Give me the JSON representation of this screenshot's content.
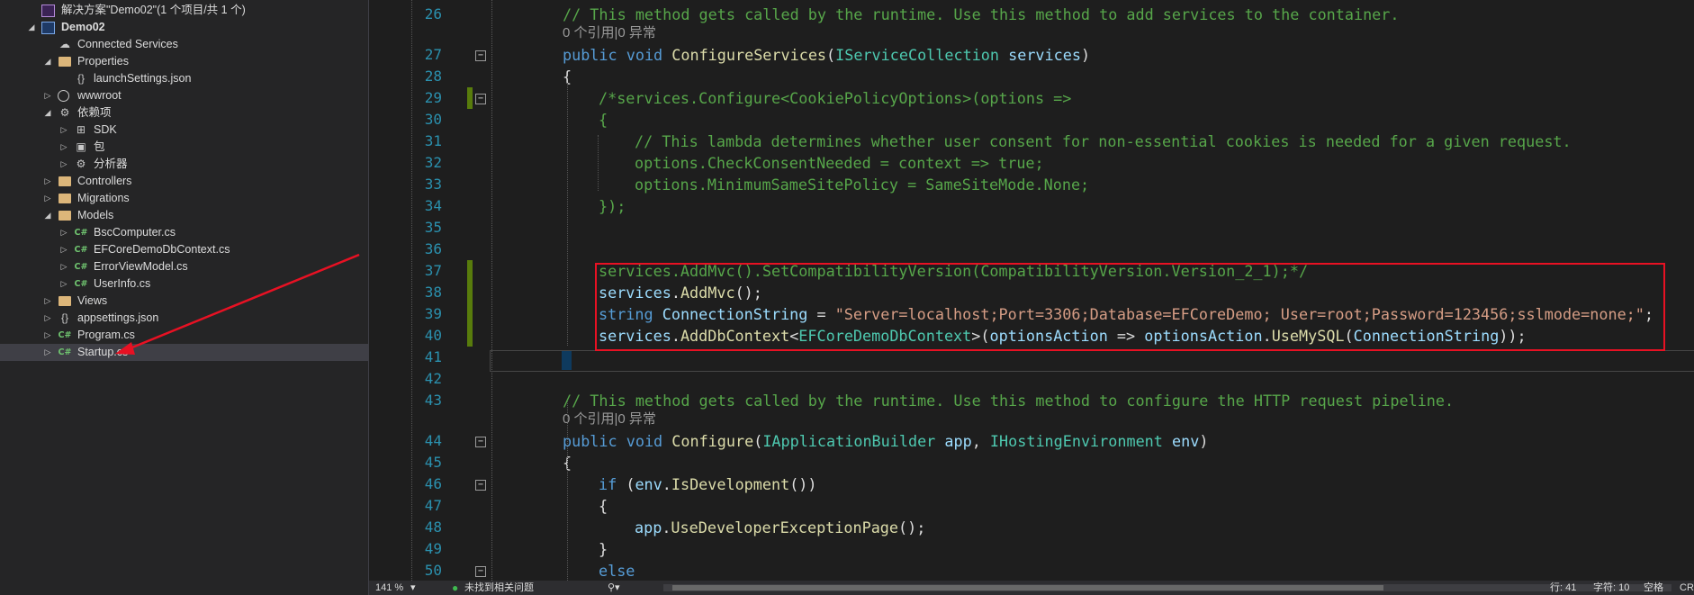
{
  "solution_explorer": {
    "items": [
      {
        "label": "解决方案\"Demo02\"(1 个项目/共 1 个)",
        "level": 0,
        "icon": "solution-icon",
        "expander": "",
        "bold": false
      },
      {
        "label": "Demo02",
        "level": 0,
        "icon": "project-icon",
        "expander": "◢",
        "bold": true
      },
      {
        "label": "Connected Services",
        "level": 1,
        "icon": "connected-services-icon",
        "expander": "",
        "bold": false
      },
      {
        "label": "Properties",
        "level": 1,
        "icon": "properties-folder-icon",
        "expander": "◢",
        "bold": false
      },
      {
        "label": "launchSettings.json",
        "level": 2,
        "icon": "json-file-icon",
        "expander": "",
        "bold": false
      },
      {
        "label": "wwwroot",
        "level": 1,
        "icon": "globe-icon",
        "expander": "▷",
        "bold": false
      },
      {
        "label": "依赖项",
        "level": 1,
        "icon": "dependencies-icon",
        "expander": "◢",
        "bold": false
      },
      {
        "label": "SDK",
        "level": 2,
        "icon": "sdk-icon",
        "expander": "▷",
        "bold": false
      },
      {
        "label": "包",
        "level": 2,
        "icon": "package-icon",
        "expander": "▷",
        "bold": false
      },
      {
        "label": "分析器",
        "level": 2,
        "icon": "analyzer-icon",
        "expander": "▷",
        "bold": false
      },
      {
        "label": "Controllers",
        "level": 1,
        "icon": "folder-icon",
        "expander": "▷",
        "bold": false
      },
      {
        "label": "Migrations",
        "level": 1,
        "icon": "folder-icon",
        "expander": "▷",
        "bold": false
      },
      {
        "label": "Models",
        "level": 1,
        "icon": "folder-icon",
        "expander": "◢",
        "bold": false
      },
      {
        "label": "BscComputer.cs",
        "level": 2,
        "icon": "csharp-file-icon",
        "expander": "▷",
        "bold": false
      },
      {
        "label": "EFCoreDemoDbContext.cs",
        "level": 2,
        "icon": "csharp-file-icon",
        "expander": "▷",
        "bold": false
      },
      {
        "label": "ErrorViewModel.cs",
        "level": 2,
        "icon": "csharp-file-icon",
        "expander": "▷",
        "bold": false
      },
      {
        "label": "UserInfo.cs",
        "level": 2,
        "icon": "csharp-file-icon",
        "expander": "▷",
        "bold": false
      },
      {
        "label": "Views",
        "level": 1,
        "icon": "folder-icon",
        "expander": "▷",
        "bold": false
      },
      {
        "label": "appsettings.json",
        "level": 1,
        "icon": "json-file-icon",
        "expander": "▷",
        "bold": false
      },
      {
        "label": "Program.cs",
        "level": 1,
        "icon": "csharp-file-icon",
        "expander": "▷",
        "bold": false
      },
      {
        "label": "Startup.cs",
        "level": 1,
        "icon": "csharp-file-icon",
        "expander": "▷",
        "bold": false,
        "selected": true
      }
    ]
  },
  "editor": {
    "lines": [
      {
        "kind": "code",
        "no": "26",
        "indent": 0,
        "tokens": [
          [
            "com",
            "// This method gets called by the runtime. Use this method to add services to the container."
          ]
        ]
      },
      {
        "kind": "lens",
        "text": "0 个引用|0 异常"
      },
      {
        "kind": "code",
        "no": "27",
        "indent": 0,
        "fold": "−",
        "tokens": [
          [
            "kw",
            "public"
          ],
          [
            "plain",
            " "
          ],
          [
            "kw",
            "void"
          ],
          [
            "plain",
            " "
          ],
          [
            "meth",
            "ConfigureServices"
          ],
          [
            "plain",
            "("
          ],
          [
            "type",
            "IServiceCollection"
          ],
          [
            "plain",
            " "
          ],
          [
            "id",
            "services"
          ],
          [
            "plain",
            ")"
          ]
        ]
      },
      {
        "kind": "code",
        "no": "28",
        "indent": 0,
        "tokens": [
          [
            "plain",
            "{"
          ]
        ]
      },
      {
        "kind": "code",
        "no": "29",
        "indent": 1,
        "change": true,
        "fold": "−",
        "tokens": [
          [
            "com",
            "/*services.Configure<CookiePolicyOptions>(options =>"
          ]
        ]
      },
      {
        "kind": "code",
        "no": "30",
        "indent": 1,
        "tokens": [
          [
            "com",
            "{"
          ]
        ]
      },
      {
        "kind": "code",
        "no": "31",
        "indent": 2,
        "tokens": [
          [
            "com",
            "// This lambda determines whether user consent for non-essential cookies is needed for a given request."
          ]
        ]
      },
      {
        "kind": "code",
        "no": "32",
        "indent": 2,
        "tokens": [
          [
            "com",
            "options.CheckConsentNeeded = context => true;"
          ]
        ]
      },
      {
        "kind": "code",
        "no": "33",
        "indent": 2,
        "tokens": [
          [
            "com",
            "options.MinimumSameSitePolicy = SameSiteMode.None;"
          ]
        ]
      },
      {
        "kind": "code",
        "no": "34",
        "indent": 1,
        "tokens": [
          [
            "com",
            "});"
          ]
        ]
      },
      {
        "kind": "code",
        "no": "35",
        "indent": 0,
        "tokens": []
      },
      {
        "kind": "code",
        "no": "36",
        "indent": 0,
        "tokens": []
      },
      {
        "kind": "code",
        "no": "37",
        "indent": 1,
        "change": true,
        "tokens": [
          [
            "com",
            "services.AddMvc().SetCompatibilityVersion(CompatibilityVersion.Version_2_1);*/"
          ]
        ]
      },
      {
        "kind": "code",
        "no": "38",
        "indent": 1,
        "change": true,
        "tokens": [
          [
            "id",
            "services"
          ],
          [
            "plain",
            "."
          ],
          [
            "meth",
            "AddMvc"
          ],
          [
            "plain",
            "();"
          ]
        ]
      },
      {
        "kind": "code",
        "no": "39",
        "indent": 1,
        "change": true,
        "tokens": [
          [
            "kw",
            "string"
          ],
          [
            "plain",
            " "
          ],
          [
            "id",
            "ConnectionString"
          ],
          [
            "plain",
            " = "
          ],
          [
            "str",
            "\"Server=localhost;Port=3306;Database=EFCoreDemo; User=root;Password=123456;sslmode=none;\""
          ],
          [
            "plain",
            ";"
          ]
        ]
      },
      {
        "kind": "code",
        "no": "40",
        "indent": 1,
        "change": true,
        "tokens": [
          [
            "id",
            "services"
          ],
          [
            "plain",
            "."
          ],
          [
            "meth",
            "AddDbContext"
          ],
          [
            "plain",
            "<"
          ],
          [
            "type",
            "EFCoreDemoDbContext"
          ],
          [
            "plain",
            ">("
          ],
          [
            "id",
            "optionsAction"
          ],
          [
            "plain",
            " => "
          ],
          [
            "id",
            "optionsAction"
          ],
          [
            "plain",
            "."
          ],
          [
            "meth",
            "UseMySQL"
          ],
          [
            "plain",
            "("
          ],
          [
            "id",
            "ConnectionString"
          ],
          [
            "plain",
            "));"
          ]
        ]
      },
      {
        "kind": "code",
        "no": "41",
        "indent": 0,
        "tokens": [
          [
            "plain",
            "}"
          ]
        ]
      },
      {
        "kind": "code",
        "no": "42",
        "indent": 0,
        "tokens": []
      },
      {
        "kind": "code",
        "no": "43",
        "indent": 0,
        "tokens": [
          [
            "com",
            "// This method gets called by the runtime. Use this method to configure the HTTP request pipeline."
          ]
        ]
      },
      {
        "kind": "lens",
        "text": "0 个引用|0 异常"
      },
      {
        "kind": "code",
        "no": "44",
        "indent": 0,
        "fold": "−",
        "tokens": [
          [
            "kw",
            "public"
          ],
          [
            "plain",
            " "
          ],
          [
            "kw",
            "void"
          ],
          [
            "plain",
            " "
          ],
          [
            "meth",
            "Configure"
          ],
          [
            "plain",
            "("
          ],
          [
            "type",
            "IApplicationBuilder"
          ],
          [
            "plain",
            " "
          ],
          [
            "id",
            "app"
          ],
          [
            "plain",
            ", "
          ],
          [
            "type",
            "IHostingEnvironment"
          ],
          [
            "plain",
            " "
          ],
          [
            "id",
            "env"
          ],
          [
            "plain",
            ")"
          ]
        ]
      },
      {
        "kind": "code",
        "no": "45",
        "indent": 0,
        "tokens": [
          [
            "plain",
            "{"
          ]
        ]
      },
      {
        "kind": "code",
        "no": "46",
        "indent": 1,
        "fold": "−",
        "tokens": [
          [
            "kw",
            "if"
          ],
          [
            "plain",
            " ("
          ],
          [
            "id",
            "env"
          ],
          [
            "plain",
            "."
          ],
          [
            "meth",
            "IsDevelopment"
          ],
          [
            "plain",
            "())"
          ]
        ]
      },
      {
        "kind": "code",
        "no": "47",
        "indent": 1,
        "tokens": [
          [
            "plain",
            "{"
          ]
        ]
      },
      {
        "kind": "code",
        "no": "48",
        "indent": 2,
        "tokens": [
          [
            "id",
            "app"
          ],
          [
            "plain",
            "."
          ],
          [
            "meth",
            "UseDeveloperExceptionPage"
          ],
          [
            "plain",
            "();"
          ]
        ]
      },
      {
        "kind": "code",
        "no": "49",
        "indent": 1,
        "tokens": [
          [
            "plain",
            "}"
          ]
        ]
      },
      {
        "kind": "code",
        "no": "50",
        "indent": 1,
        "fold": "−",
        "tokens": [
          [
            "kw",
            "else"
          ]
        ]
      }
    ]
  },
  "statusbar": {
    "zoom": "141 %",
    "zoom_dropdown": "▾",
    "issues_icon": "check-circle-icon",
    "issues": "未找到相关问题",
    "brush": "⚲▾",
    "line": "行: 41",
    "char": "字符: 10",
    "spaces": "空格",
    "encoding": "CR"
  },
  "colors": {
    "comment": "#57a64a",
    "keyword": "#569cd6",
    "type": "#4ec9b0",
    "method": "#dcdcaa",
    "string": "#d69d85",
    "identifier": "#9cdcfe",
    "highlight_box": "#e81123",
    "annotation_arrow": "#e81123"
  }
}
